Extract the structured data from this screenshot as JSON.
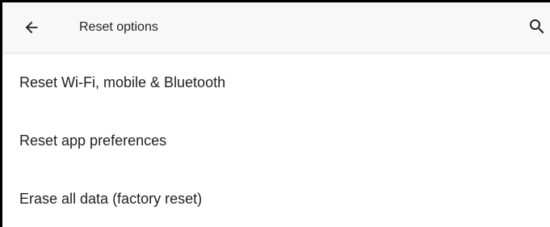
{
  "toolbar": {
    "title": "Reset options",
    "back_icon": "arrow-back-icon",
    "search_icon": "search-icon"
  },
  "list": {
    "items": [
      {
        "label": "Reset Wi-Fi, mobile & Bluetooth"
      },
      {
        "label": "Reset app preferences"
      },
      {
        "label": "Erase all data (factory reset)"
      }
    ]
  },
  "colors": {
    "toolbar_background": "#f8f8f8",
    "page_background": "#ffffff",
    "text_primary": "#202124",
    "frame_border": "#000000"
  }
}
